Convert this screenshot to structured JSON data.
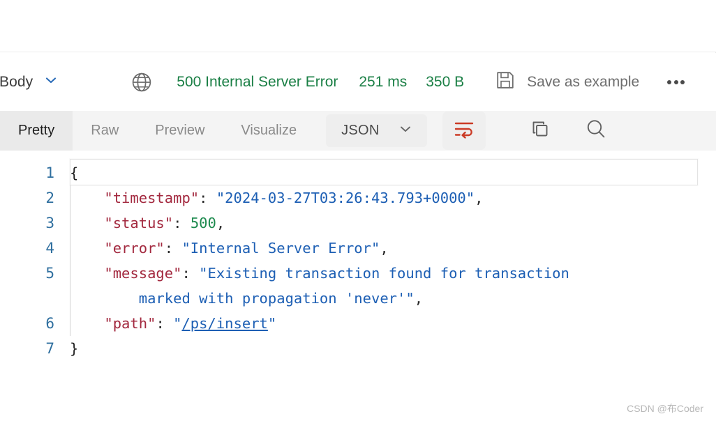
{
  "header": {
    "body_label": "Body",
    "body_chevron_icon": "chevron-down-icon",
    "globe_icon": "globe-icon",
    "status_code": "500",
    "status_text": "500 Internal Server Error",
    "time": "251 ms",
    "size": "350 B",
    "save_icon": "floppy-disk-save-icon",
    "save_as_example_label": "Save as example",
    "more_icon": "ellipsis-horizontal-icon"
  },
  "tabs": {
    "items": [
      {
        "label": "Pretty",
        "active": true
      },
      {
        "label": "Raw",
        "active": false
      },
      {
        "label": "Preview",
        "active": false
      },
      {
        "label": "Visualize",
        "active": false
      }
    ],
    "format_selected": "JSON",
    "format_chevron_icon": "chevron-down-icon",
    "wrap_icon": "word-wrap-icon",
    "copy_icon": "copy-icon",
    "search_icon": "search-icon"
  },
  "code": {
    "line_numbers": [
      "1",
      "2",
      "3",
      "4",
      "5",
      "",
      "6",
      "7"
    ],
    "lines": [
      {
        "n": 1,
        "indent": 0,
        "tokens": [
          {
            "t": "brace",
            "v": "{"
          }
        ]
      },
      {
        "n": 2,
        "indent": 1,
        "tokens": [
          {
            "t": "k",
            "v": "\"timestamp\""
          },
          {
            "t": "p",
            "v": ": "
          },
          {
            "t": "s",
            "v": "\"2024-03-27T03:26:43.793+0000\""
          },
          {
            "t": "p",
            "v": ","
          }
        ]
      },
      {
        "n": 3,
        "indent": 1,
        "tokens": [
          {
            "t": "k",
            "v": "\"status\""
          },
          {
            "t": "p",
            "v": ": "
          },
          {
            "t": "n",
            "v": "500"
          },
          {
            "t": "p",
            "v": ","
          }
        ]
      },
      {
        "n": 4,
        "indent": 1,
        "tokens": [
          {
            "t": "k",
            "v": "\"error\""
          },
          {
            "t": "p",
            "v": ": "
          },
          {
            "t": "s",
            "v": "\"Internal Server Error\""
          },
          {
            "t": "p",
            "v": ","
          }
        ]
      },
      {
        "n": 5,
        "indent": 1,
        "tokens": [
          {
            "t": "k",
            "v": "\"message\""
          },
          {
            "t": "p",
            "v": ": "
          },
          {
            "t": "s",
            "v": "\"Existing transaction found for transaction"
          }
        ]
      },
      {
        "n": null,
        "indent": 2,
        "tokens": [
          {
            "t": "s",
            "v": "marked with propagation 'never'\""
          },
          {
            "t": "p",
            "v": ","
          }
        ]
      },
      {
        "n": 6,
        "indent": 1,
        "tokens": [
          {
            "t": "k",
            "v": "\"path\""
          },
          {
            "t": "p",
            "v": ": "
          },
          {
            "t": "s",
            "v": "\""
          },
          {
            "t": "link",
            "v": "/ps/insert"
          },
          {
            "t": "s",
            "v": "\""
          }
        ]
      },
      {
        "n": 7,
        "indent": 0,
        "tokens": [
          {
            "t": "brace",
            "v": "}"
          }
        ]
      }
    ],
    "raw_json": {
      "timestamp": "2024-03-27T03:26:43.793+0000",
      "status": 500,
      "error": "Internal Server Error",
      "message": "Existing transaction found for transaction marked with propagation 'never'",
      "path": "/ps/insert"
    }
  },
  "watermark": "CSDN @布Coder",
  "colors": {
    "status_green": "#1a7f45",
    "json_key": "#a3293f",
    "json_string": "#1d5fb4",
    "json_number": "#1d8a4e",
    "gutter_number": "#2f6f9f",
    "wrap_active": "#cb3b26",
    "tab_bar_bg": "#f4f4f4",
    "tab_active_bg": "#eaeaea"
  }
}
